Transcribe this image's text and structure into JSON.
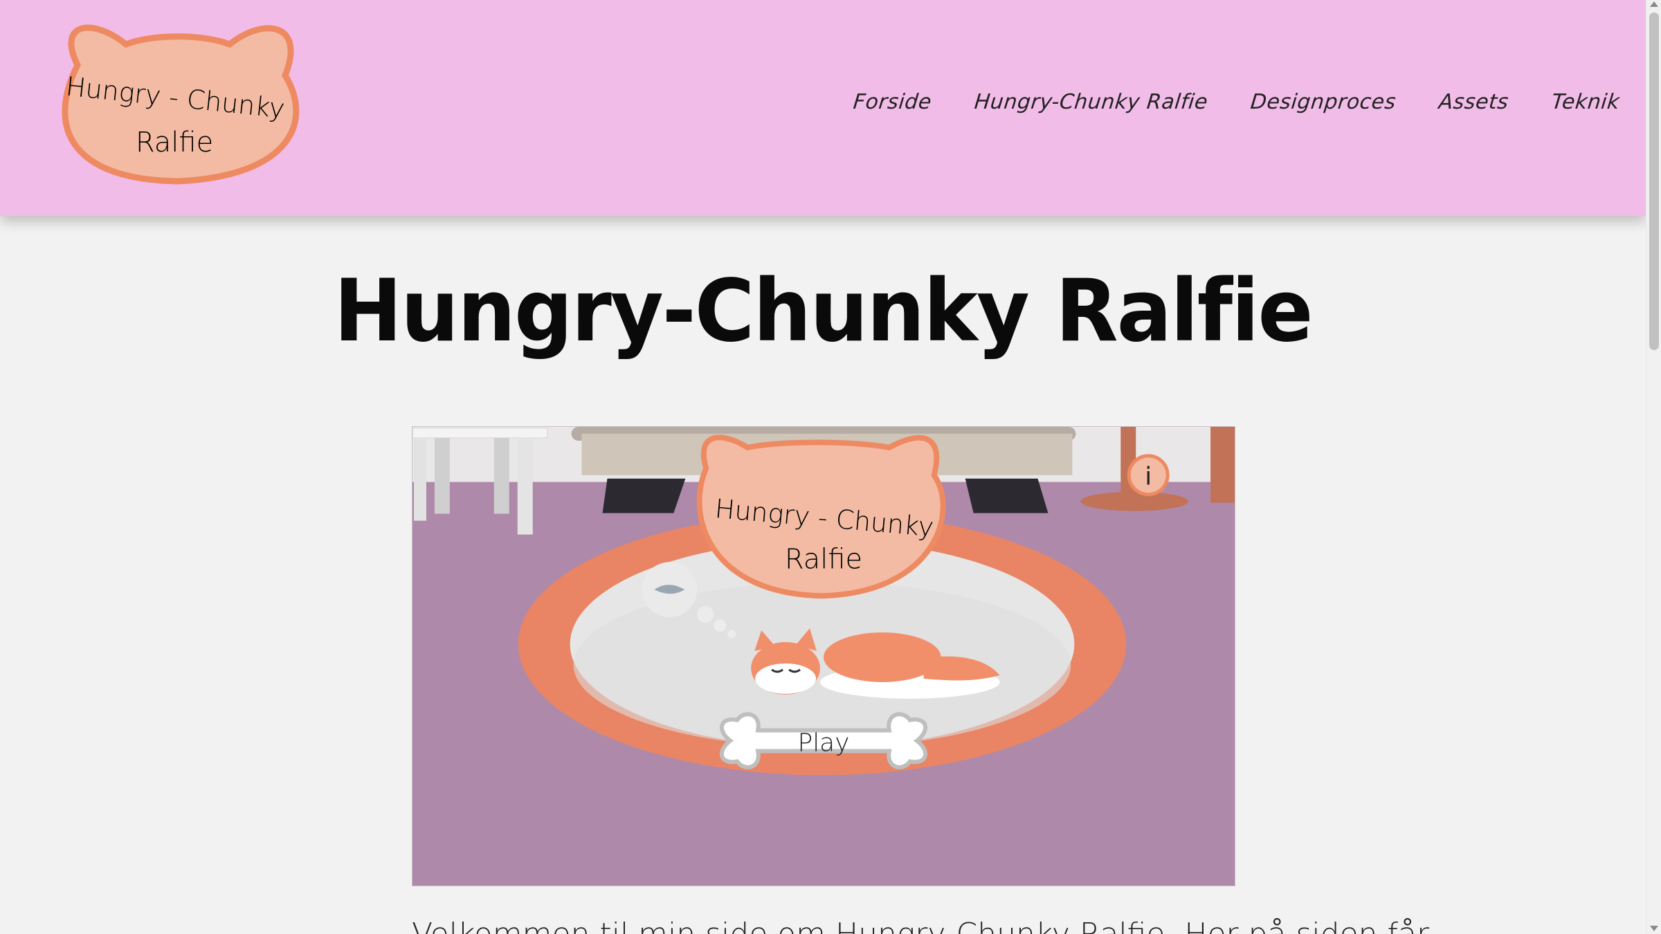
{
  "header": {
    "logo": {
      "line1": "Hungry - Chunky",
      "line2": "Ralfie"
    },
    "nav": [
      {
        "label": "Forside"
      },
      {
        "label": "Hungry-Chunky Ralfie"
      },
      {
        "label": "Designproces"
      },
      {
        "label": "Assets"
      },
      {
        "label": "Teknik"
      }
    ],
    "background_color": "#f2bce9"
  },
  "main": {
    "title": "Hungry-Chunky Ralfie",
    "game": {
      "logo_line1": "Hungry - Chunky",
      "logo_line2": "Ralfie",
      "play_label": "Play",
      "info_label": "i",
      "background_color": "#ae89a9"
    },
    "intro_text": "Velkommen til min side om Hungry-Chunky Ralfie. Her på siden får"
  },
  "colors": {
    "accent_orange": "#ee8a62",
    "logo_fill": "#f3bba3",
    "page_bg": "#f2f2f2"
  }
}
